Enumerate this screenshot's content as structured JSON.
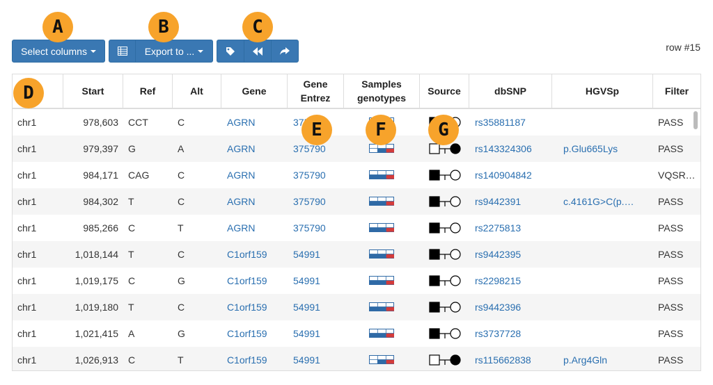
{
  "toolbar": {
    "select_columns_label": "Select columns",
    "export_label": "Export to ...",
    "row_count": "row #15"
  },
  "callouts": [
    "A",
    "B",
    "C",
    "D",
    "E",
    "F",
    "G"
  ],
  "table": {
    "columns": [
      {
        "key": "chrom",
        "label": ""
      },
      {
        "key": "start",
        "label": "Start"
      },
      {
        "key": "ref",
        "label": "Ref"
      },
      {
        "key": "alt",
        "label": "Alt"
      },
      {
        "key": "gene",
        "label": "Gene"
      },
      {
        "key": "entrez",
        "label": "Gene Entrez"
      },
      {
        "key": "samples",
        "label": "Samples genotypes"
      },
      {
        "key": "source",
        "label": "Source"
      },
      {
        "key": "dbsnp",
        "label": "dbSNP"
      },
      {
        "key": "hgvsp",
        "label": "HGVSp"
      },
      {
        "key": "filter",
        "label": "Filter"
      }
    ],
    "rows": [
      {
        "chrom": "chr1",
        "start": "978,603",
        "ref": "CCT",
        "alt": "C",
        "gene": "AGRN",
        "entrez": "375790",
        "genotypes": [
          "empty",
          "blue",
          "empty"
        ],
        "source": [
          "filled",
          "empty"
        ],
        "dbsnp": "rs35881187",
        "hgvsp": "",
        "filter": "PASS"
      },
      {
        "chrom": "chr1",
        "start": "979,397",
        "ref": "G",
        "alt": "A",
        "gene": "AGRN",
        "entrez": "375790",
        "genotypes": [
          "empty",
          "blue",
          "red"
        ],
        "source": [
          "empty",
          "filled"
        ],
        "dbsnp": "rs143324306",
        "hgvsp": "p.Glu665Lys",
        "filter": "PASS"
      },
      {
        "chrom": "chr1",
        "start": "984,171",
        "ref": "CAG",
        "alt": "C",
        "gene": "AGRN",
        "entrez": "375790",
        "genotypes": [
          "blue",
          "blue",
          "red"
        ],
        "source": [
          "filled",
          "empty"
        ],
        "dbsnp": "rs140904842",
        "hgvsp": "",
        "filter": "VQSRTr…"
      },
      {
        "chrom": "chr1",
        "start": "984,302",
        "ref": "T",
        "alt": "C",
        "gene": "AGRN",
        "entrez": "375790",
        "genotypes": [
          "blue",
          "blue",
          "red"
        ],
        "source": [
          "filled",
          "empty"
        ],
        "dbsnp": "rs9442391",
        "hgvsp": "c.4161G>C(p.…",
        "filter": "PASS"
      },
      {
        "chrom": "chr1",
        "start": "985,266",
        "ref": "C",
        "alt": "T",
        "gene": "AGRN",
        "entrez": "375790",
        "genotypes": [
          "blue",
          "blue",
          "red"
        ],
        "source": [
          "filled",
          "empty"
        ],
        "dbsnp": "rs2275813",
        "hgvsp": "",
        "filter": "PASS"
      },
      {
        "chrom": "chr1",
        "start": "1,018,144",
        "ref": "T",
        "alt": "C",
        "gene": "C1orf159",
        "entrez": "54991",
        "genotypes": [
          "blue",
          "blue",
          "red"
        ],
        "source": [
          "filled",
          "empty"
        ],
        "dbsnp": "rs9442395",
        "hgvsp": "",
        "filter": "PASS"
      },
      {
        "chrom": "chr1",
        "start": "1,019,175",
        "ref": "C",
        "alt": "G",
        "gene": "C1orf159",
        "entrez": "54991",
        "genotypes": [
          "blue",
          "blue",
          "red"
        ],
        "source": [
          "filled",
          "empty"
        ],
        "dbsnp": "rs2298215",
        "hgvsp": "",
        "filter": "PASS"
      },
      {
        "chrom": "chr1",
        "start": "1,019,180",
        "ref": "T",
        "alt": "C",
        "gene": "C1orf159",
        "entrez": "54991",
        "genotypes": [
          "blue",
          "blue",
          "red"
        ],
        "source": [
          "filled",
          "empty"
        ],
        "dbsnp": "rs9442396",
        "hgvsp": "",
        "filter": "PASS"
      },
      {
        "chrom": "chr1",
        "start": "1,021,415",
        "ref": "A",
        "alt": "G",
        "gene": "C1orf159",
        "entrez": "54991",
        "genotypes": [
          "blue",
          "blue",
          "red"
        ],
        "source": [
          "filled",
          "empty"
        ],
        "dbsnp": "rs3737728",
        "hgvsp": "",
        "filter": "PASS"
      },
      {
        "chrom": "chr1",
        "start": "1,026,913",
        "ref": "C",
        "alt": "T",
        "gene": "C1orf159",
        "entrez": "54991",
        "genotypes": [
          "empty",
          "blue",
          "red"
        ],
        "source": [
          "empty",
          "filled"
        ],
        "dbsnp": "rs115662838",
        "hgvsp": "p.Arg4Gln",
        "filter": "PASS"
      }
    ]
  },
  "colors": {
    "button": "#3a78b3",
    "link": "#2a6fb0",
    "callout": "#f7a32b",
    "genotype_blue": "#2f6aa6",
    "genotype_red": "#d33b3b"
  }
}
